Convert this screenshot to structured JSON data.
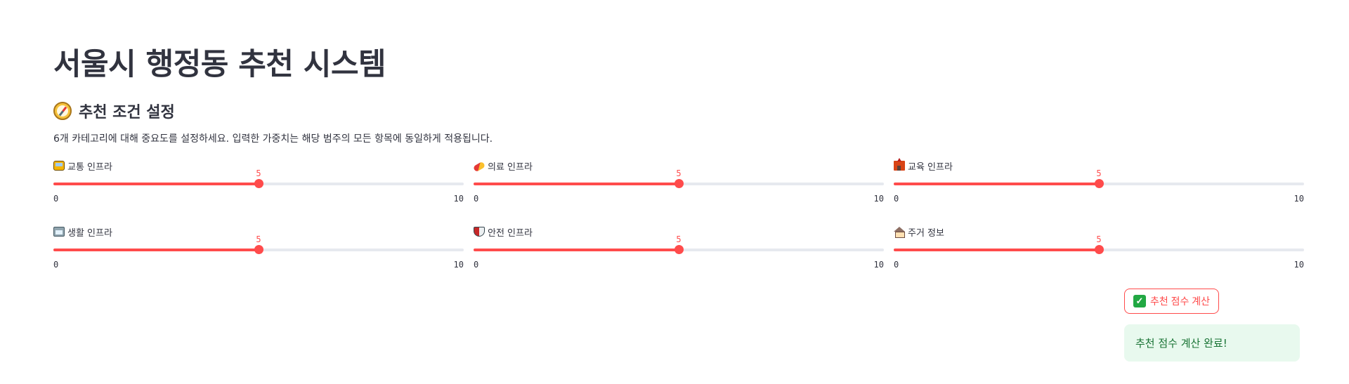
{
  "title": "서울시 행정동 추천 시스템",
  "section": {
    "icon": "compass-icon",
    "title": "추천 조건 설정",
    "description": "6개 카테고리에 대해 중요도를 설정하세요. 입력한 가중치는 해당 범주의 모든 항목에 동일하게 적용됩니다."
  },
  "sliders": [
    {
      "icon": "bus-icon",
      "label": "교통 인프라",
      "value": 5,
      "min": 0,
      "max": 10
    },
    {
      "icon": "pill-icon",
      "label": "의료 인프라",
      "value": 5,
      "min": 0,
      "max": 10
    },
    {
      "icon": "school-icon",
      "label": "교육 인프라",
      "value": 5,
      "min": 0,
      "max": 10
    },
    {
      "icon": "convenience-store-icon",
      "label": "생활 인프라",
      "value": 5,
      "min": 0,
      "max": 10
    },
    {
      "icon": "shield-icon",
      "label": "안전 인프라",
      "value": 5,
      "min": 0,
      "max": 10
    },
    {
      "icon": "house-icon",
      "label": "주거 정보",
      "value": 5,
      "min": 0,
      "max": 10
    }
  ],
  "button": {
    "icon": "check-mark-icon",
    "label": "추천 점수 계산"
  },
  "success": {
    "message": "추천 점수 계산 완료!"
  },
  "colors": {
    "accent": "#ff4b4b",
    "track": "#e6e9ef",
    "success_bg": "#e8f9ee",
    "success_text": "#177233"
  }
}
